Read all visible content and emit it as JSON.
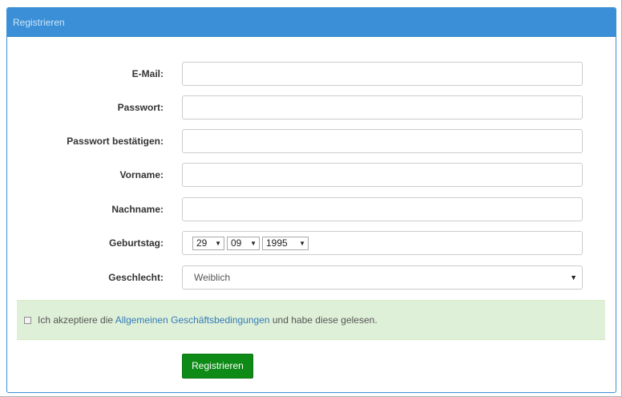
{
  "panel": {
    "title": "Registrieren"
  },
  "form": {
    "email": {
      "label": "E-Mail:",
      "value": ""
    },
    "password": {
      "label": "Passwort:",
      "value": ""
    },
    "password_confirm": {
      "label": "Passwort bestätigen:",
      "value": ""
    },
    "first_name": {
      "label": "Vorname:",
      "value": ""
    },
    "last_name": {
      "label": "Nachname:",
      "value": ""
    },
    "birthday": {
      "label": "Geburtstag:",
      "day": "29",
      "month": "09",
      "year": "1995"
    },
    "gender": {
      "label": "Geschlecht:",
      "selected": "Weiblich"
    }
  },
  "agb": {
    "checked": false,
    "text_before": "Ich akzeptiere die ",
    "link_text": "Allgemeinen Geschäftsbedingungen",
    "text_after": " und habe diese gelesen."
  },
  "submit_label": "Registrieren",
  "colors": {
    "heading": "#3a8fd6",
    "success_bg": "#dff0d8",
    "submit_bg": "#0e8a16",
    "link": "#337ab7"
  }
}
